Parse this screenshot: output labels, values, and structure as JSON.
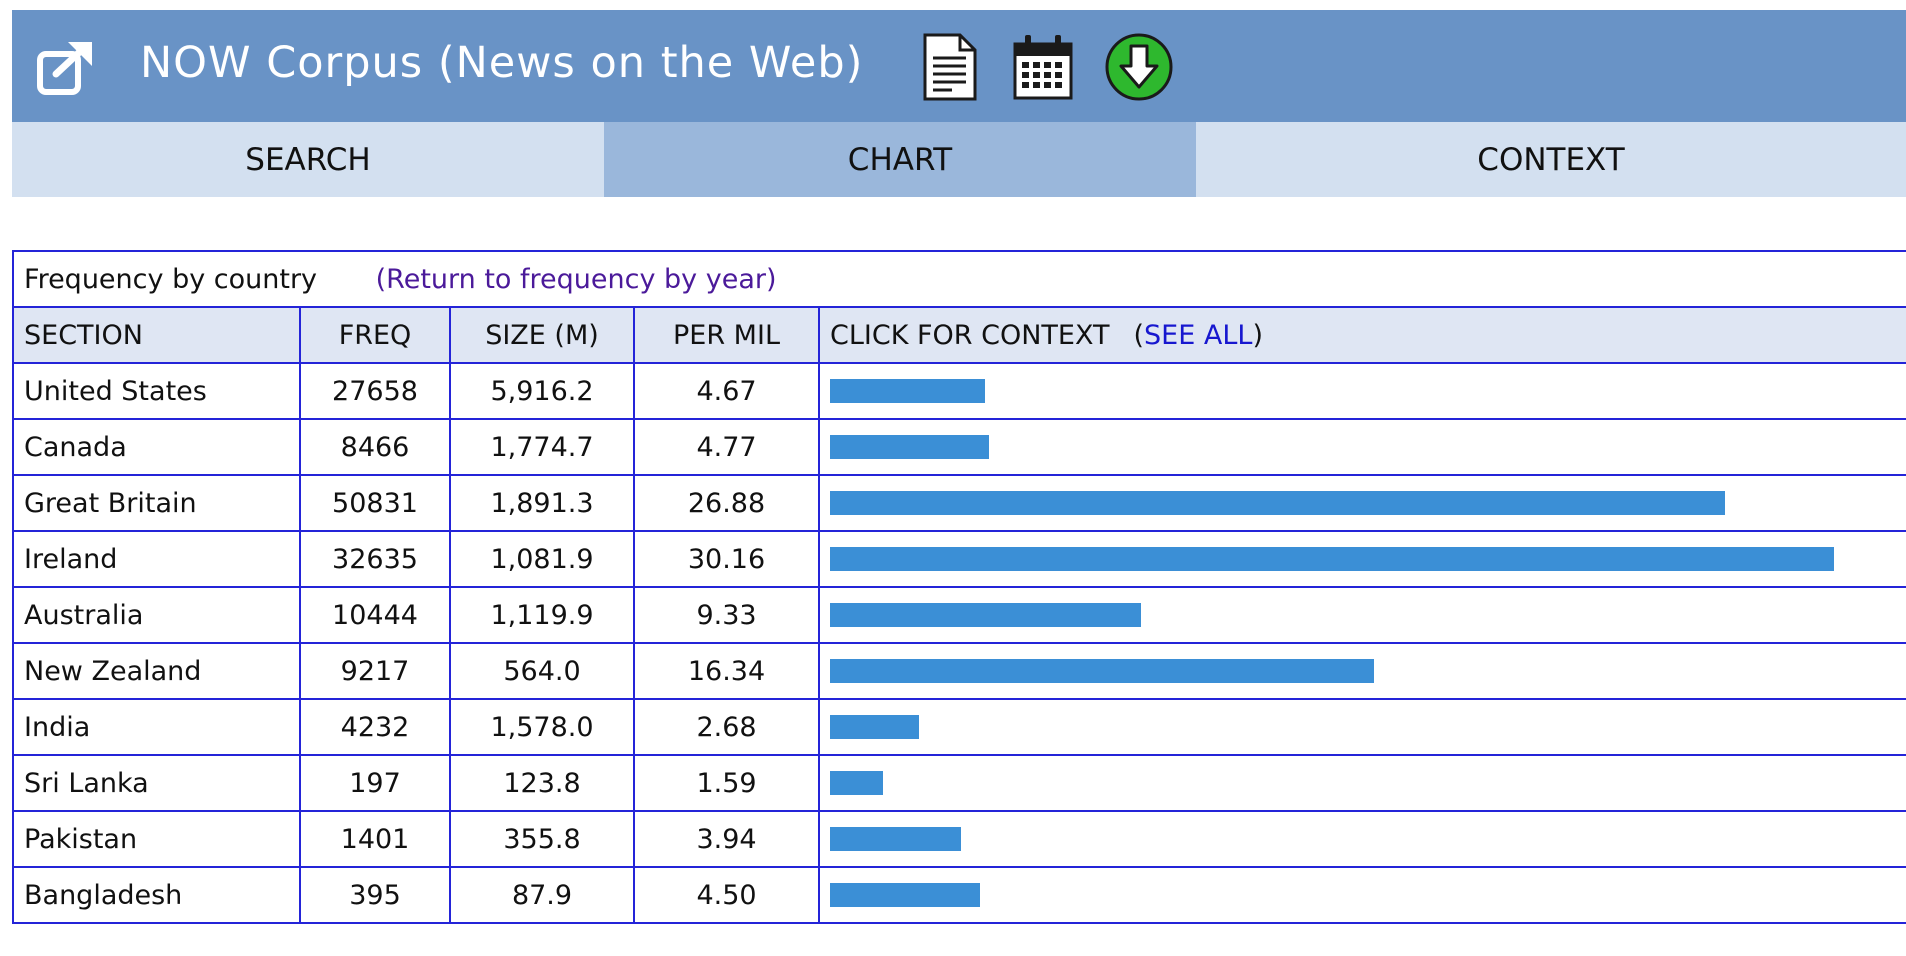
{
  "header": {
    "title": "NOW Corpus (News on the Web)",
    "icons": [
      "open-external-icon",
      "document-icon",
      "calendar-icon",
      "download-icon"
    ],
    "colors": {
      "header_bg": "#6993c6",
      "tab_bg": "#d3e0f0",
      "tab_active_bg": "#9ab7db"
    }
  },
  "tabs": [
    {
      "label": "SEARCH",
      "active": false
    },
    {
      "label": "CHART",
      "active": true
    },
    {
      "label": "CONTEXT",
      "active": false
    }
  ],
  "table": {
    "caption": "Frequency by country",
    "return_link": "(Return to frequency by year)",
    "columns": {
      "section": "SECTION",
      "freq": "FREQ",
      "size": "SIZE (M)",
      "per_mil": "PER MIL",
      "context": "CLICK FOR CONTEXT",
      "see_all_open": "(",
      "see_all": "SEE ALL",
      "see_all_close": ")"
    },
    "rows": [
      {
        "section": "United States",
        "freq": "27658",
        "size": "5,916.2",
        "per_mil": "4.67"
      },
      {
        "section": "Canada",
        "freq": "8466",
        "size": "1,774.7",
        "per_mil": "4.77"
      },
      {
        "section": "Great Britain",
        "freq": "50831",
        "size": "1,891.3",
        "per_mil": "26.88"
      },
      {
        "section": "Ireland",
        "freq": "32635",
        "size": "1,081.9",
        "per_mil": "30.16"
      },
      {
        "section": "Australia",
        "freq": "10444",
        "size": "1,119.9",
        "per_mil": "9.33"
      },
      {
        "section": "New Zealand",
        "freq": "9217",
        "size": "564.0",
        "per_mil": "16.34"
      },
      {
        "section": "India",
        "freq": "4232",
        "size": "1,578.0",
        "per_mil": "2.68"
      },
      {
        "section": "Sri Lanka",
        "freq": "197",
        "size": "123.8",
        "per_mil": "1.59"
      },
      {
        "section": "Pakistan",
        "freq": "1401",
        "size": "355.8",
        "per_mil": "3.94"
      },
      {
        "section": "Bangladesh",
        "freq": "395",
        "size": "87.9",
        "per_mil": "4.50"
      }
    ],
    "bar_color": "#3b8fd6"
  }
}
